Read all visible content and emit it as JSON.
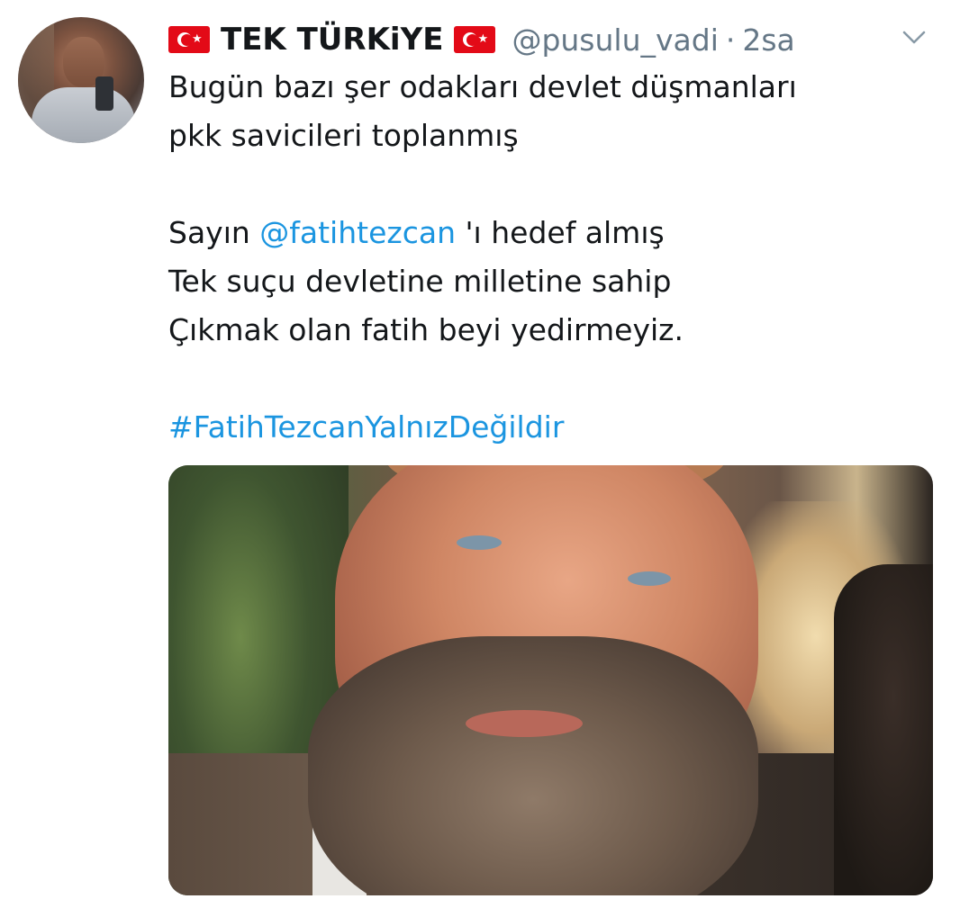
{
  "tweet": {
    "display_name": "TEK TÜRKiYE",
    "handle": "@pusulu_vadi",
    "separator": "·",
    "timestamp": "2sa",
    "menu_icon": "chevron-down-icon",
    "body": {
      "line1": "Bugün bazı şer odakları devlet düşmanları",
      "line2": "pkk savicileri toplanmış",
      "line3_prefix": "Sayın ",
      "line3_mention": "@fatihtezcan",
      "line3_suffix": " 'ı hedef almış",
      "line4": "Tek suçu devletine milletine sahip",
      "line5": "Çıkmak olan fatih beyi yedirmeyiz.",
      "hashtag": "#FatihTezcanYalnızDeğildir"
    },
    "colors": {
      "link": "#1b95e0",
      "secondary_text": "#657786",
      "primary_text": "#14171a",
      "flag_red": "#e30a17"
    }
  }
}
